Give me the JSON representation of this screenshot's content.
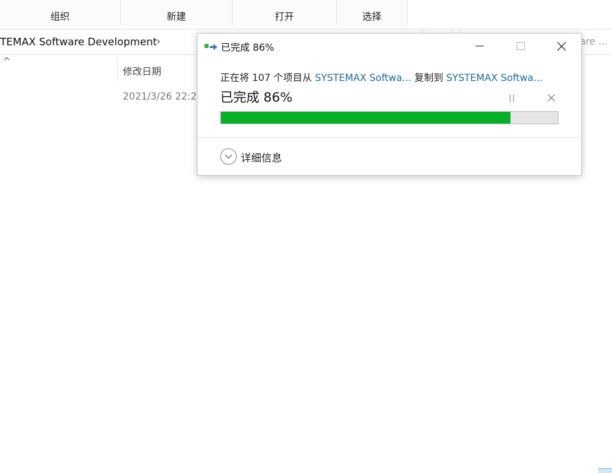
{
  "ribbon": {
    "groups": [
      {
        "label": "组织"
      },
      {
        "label": "新建"
      },
      {
        "label": "打开"
      },
      {
        "label": "选择"
      }
    ]
  },
  "address": {
    "breadcrumb": "TEMAX Software Development",
    "chevron": "›",
    "search_partial": "are ..."
  },
  "file_list": {
    "sort_indicator": "^",
    "columns": {
      "modified": "修改日期"
    },
    "rows": [
      {
        "modified": "2021/3/26 22:2"
      }
    ]
  },
  "copy_dialog": {
    "title": "已完成 86%",
    "description": {
      "prefix": "正在将 107 个项目从 ",
      "source": "SYSTEMAX Softwa...",
      "middle": " 复制到 ",
      "destination": "SYSTEMAX Softwa..."
    },
    "status": "已完成 86%",
    "progress": 0.86,
    "details_label": "详细信息",
    "colors": {
      "progress_fill": "#06b025",
      "link": "#1a6a9a"
    }
  }
}
